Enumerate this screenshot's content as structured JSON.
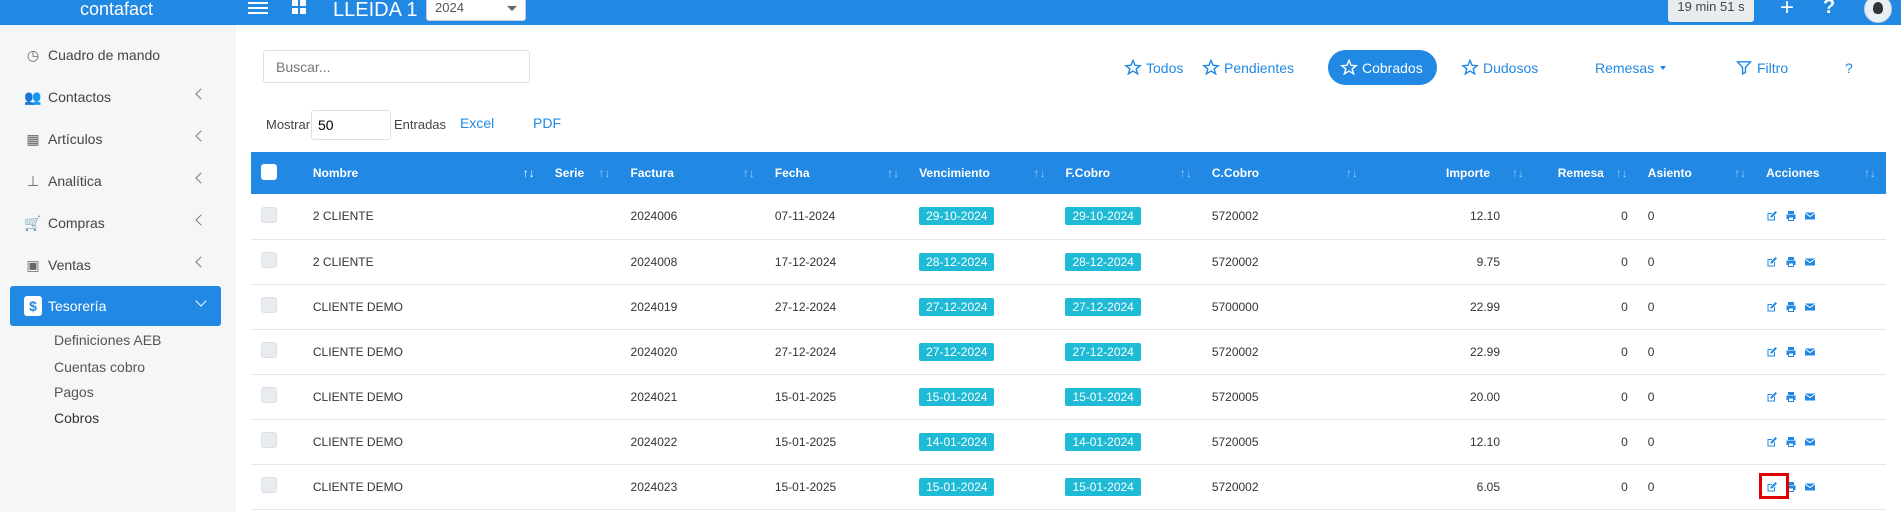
{
  "topbar": {
    "brand": "contafact",
    "company": "LLEIDA 1",
    "year": "2024",
    "timer": "19 min 51 s",
    "plus": "+",
    "help": "?"
  },
  "sidebar": {
    "items": [
      {
        "label": "Cuadro de mando",
        "icon": "dashboard-icon",
        "glyph": "◷"
      },
      {
        "label": "Contactos",
        "icon": "people-icon",
        "glyph": "👥"
      },
      {
        "label": "Artículos",
        "icon": "building-icon",
        "glyph": "▦"
      },
      {
        "label": "Analítica",
        "icon": "sitemap-icon",
        "glyph": "⊥"
      },
      {
        "label": "Compras",
        "icon": "cart-icon",
        "glyph": "🛒"
      },
      {
        "label": "Ventas",
        "icon": "ventas-icon",
        "glyph": "▣"
      },
      {
        "label": "Tesorería",
        "icon": "dollar-icon",
        "glyph": "$"
      }
    ],
    "subitems": [
      "Definiciones AEB",
      "Cuentas cobro",
      "Pagos",
      "Cobros"
    ]
  },
  "search": {
    "placeholder": "Buscar..."
  },
  "filters": {
    "todos": "Todos",
    "pendientes": "Pendientes",
    "cobrados": "Cobrados",
    "dudosos": "Dudosos",
    "remesas": "Remesas",
    "filtro": "Filtro",
    "help": "?"
  },
  "controls": {
    "mostrar": "Mostrar",
    "entries_value": "50",
    "entradas": "Entradas",
    "excel": "Excel",
    "pdf": "PDF"
  },
  "table": {
    "headers": [
      "Nombre",
      "Serie",
      "Factura",
      "Fecha",
      "Vencimiento",
      "F.Cobro",
      "C.Cobro",
      "Importe",
      "Remesa",
      "Asiento",
      "Acciones"
    ],
    "rows": [
      {
        "nombre": "2 CLIENTE",
        "serie": "",
        "factura": "2024006",
        "fecha": "07-11-2024",
        "venc": "29-10-2024",
        "fcobro": "29-10-2024",
        "ccobro": "5720002",
        "importe": "12.10",
        "remesa": "0",
        "asiento": "0"
      },
      {
        "nombre": "2 CLIENTE",
        "serie": "",
        "factura": "2024008",
        "fecha": "17-12-2024",
        "venc": "28-12-2024",
        "fcobro": "28-12-2024",
        "ccobro": "5720002",
        "importe": "9.75",
        "remesa": "0",
        "asiento": "0"
      },
      {
        "nombre": "CLIENTE DEMO",
        "serie": "",
        "factura": "2024019",
        "fecha": "27-12-2024",
        "venc": "27-12-2024",
        "fcobro": "27-12-2024",
        "ccobro": "5700000",
        "importe": "22.99",
        "remesa": "0",
        "asiento": "0"
      },
      {
        "nombre": "CLIENTE DEMO",
        "serie": "",
        "factura": "2024020",
        "fecha": "27-12-2024",
        "venc": "27-12-2024",
        "fcobro": "27-12-2024",
        "ccobro": "5720002",
        "importe": "22.99",
        "remesa": "0",
        "asiento": "0"
      },
      {
        "nombre": "CLIENTE DEMO",
        "serie": "",
        "factura": "2024021",
        "fecha": "15-01-2025",
        "venc": "15-01-2024",
        "fcobro": "15-01-2024",
        "ccobro": "5720005",
        "importe": "20.00",
        "remesa": "0",
        "asiento": "0"
      },
      {
        "nombre": "CLIENTE DEMO",
        "serie": "",
        "factura": "2024022",
        "fecha": "15-01-2025",
        "venc": "14-01-2024",
        "fcobro": "14-01-2024",
        "ccobro": "5720005",
        "importe": "12.10",
        "remesa": "0",
        "asiento": "0"
      },
      {
        "nombre": "CLIENTE DEMO",
        "serie": "",
        "factura": "2024023",
        "fecha": "15-01-2025",
        "venc": "15-01-2024",
        "fcobro": "15-01-2024",
        "ccobro": "5720002",
        "importe": "6.05",
        "remesa": "0",
        "asiento": "0"
      }
    ]
  },
  "colors": {
    "accent": "#2188e3",
    "badge": "#1fbbd6",
    "highlight": "#e00000"
  }
}
